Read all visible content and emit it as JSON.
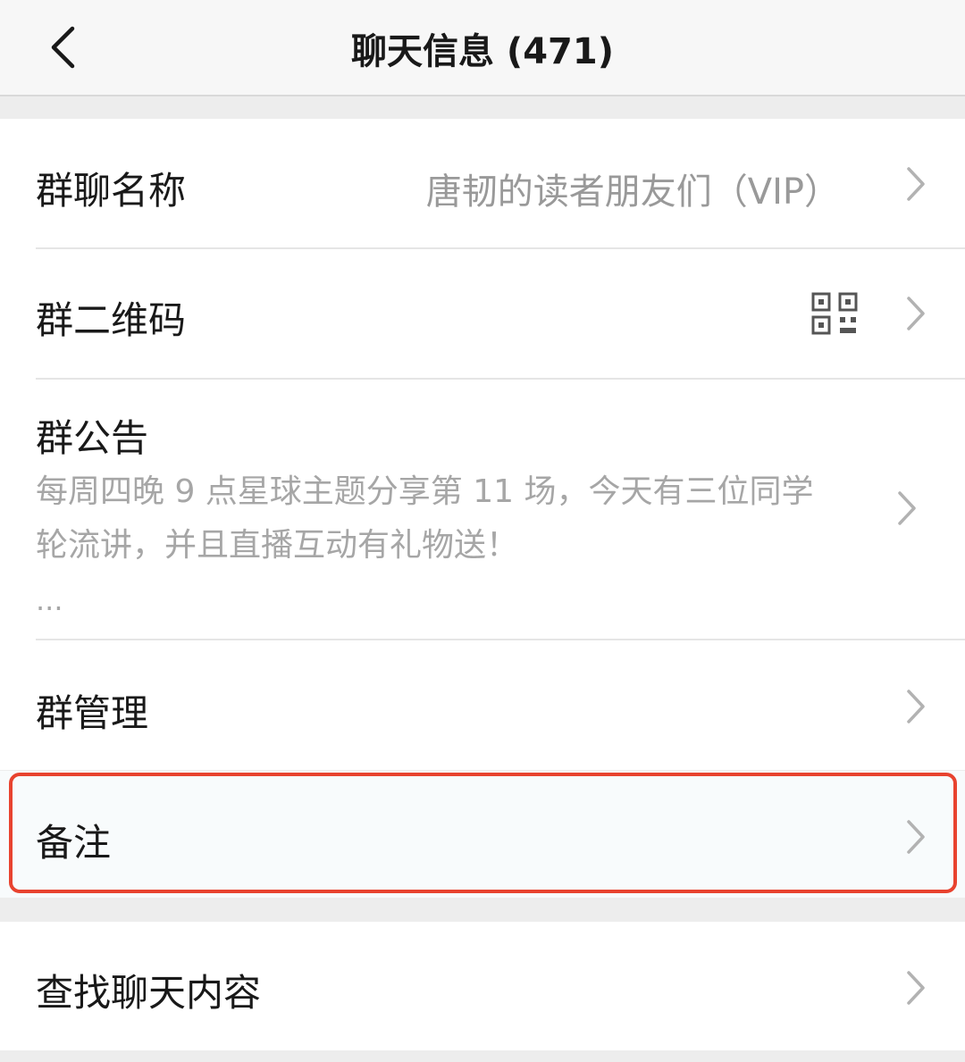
{
  "header": {
    "title": "聊天信息 (471)",
    "back_icon": "chevron-left-icon"
  },
  "settings": {
    "group_name": {
      "label": "群聊名称",
      "value": "唐韧的读者朋友们（VIP）"
    },
    "group_qr": {
      "label": "群二维码",
      "icon": "qr-code-icon"
    },
    "announcement": {
      "label": "群公告",
      "line1": "每周四晚 9 点星球主题分享第 11 场，今天有三位同学",
      "line2": "轮流讲，并且直播互动有礼物送！",
      "more": "..."
    },
    "group_manage": {
      "label": "群管理"
    },
    "remark": {
      "label": "备注",
      "highlight_color": "#e8432f"
    },
    "search_history": {
      "label": "查找聊天内容"
    }
  },
  "colors": {
    "background": "#ededed",
    "card": "#ffffff",
    "text_primary": "#191919",
    "text_secondary": "#999999",
    "highlight": "#e8432f"
  }
}
